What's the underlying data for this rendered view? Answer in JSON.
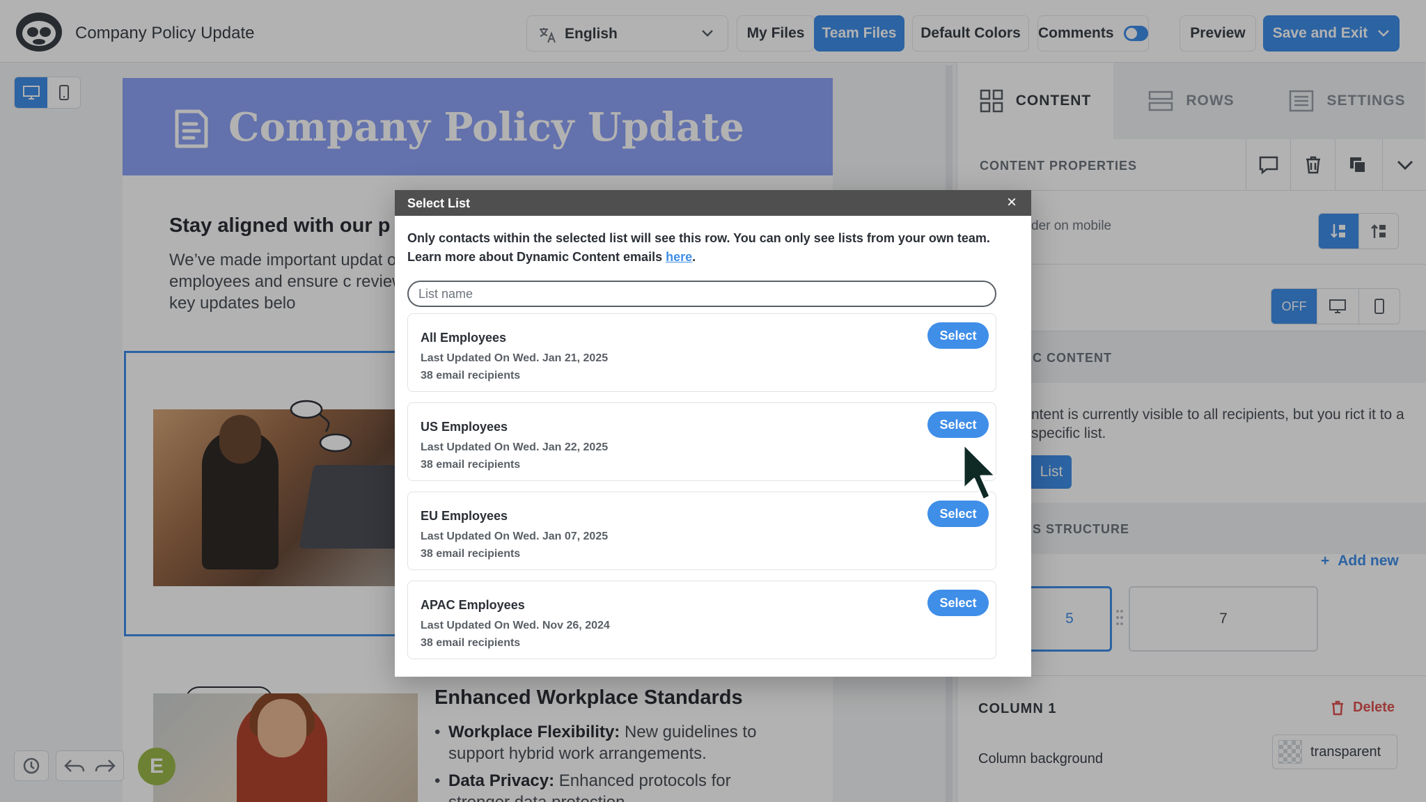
{
  "app": {
    "title": "Company Policy Update",
    "language": "English",
    "buttons": {
      "my_files": "My Files",
      "team_files": "Team Files",
      "default_colors": "Default Colors",
      "comments": "Comments",
      "preview": "Preview",
      "save_exit": "Save and Exit"
    },
    "comments_toggle_on": true
  },
  "email": {
    "hero_title": "Company Policy Update",
    "intro_heading": "Stay aligned with our p",
    "intro_text": "We’ve made important updat our employees and ensure c review the key updates belo",
    "rating_stars": "★★★★★",
    "section2_heading": "Enhanced Workplace Standards",
    "section2_items": [
      {
        "label": "Workplace Flexibility:",
        "text": " New guidelines to support hybrid work arrangements."
      },
      {
        "label": "Data Privacy:",
        "text": " Enhanced protocols for stronger data protection."
      }
    ],
    "avatar_initial": "E"
  },
  "panel": {
    "tabs": [
      "CONTENT",
      "ROWS",
      "SETTINGS"
    ],
    "active_tab": "CONTENT",
    "content_properties": "CONTENT  PROPERTIES",
    "row1_text": "der on mobile",
    "off_label": "OFF",
    "dynamic_header": "C CONTENT",
    "dynamic_body": "ntent is currently visible to all recipients, but you rict it to a specific list.",
    "list_button": "List",
    "structure_header": "S STRUCTURE",
    "add_new": "Add new",
    "columns": [
      "5",
      "7"
    ],
    "column1_heading": "COLUMN 1",
    "delete_label": "Delete",
    "column_background_label": "Column background",
    "column_background_value": "transparent"
  },
  "modal": {
    "title": "Select List",
    "close_glyph": "×",
    "description": "Only contacts within the selected list will see this row. You can only see lists from your own team. Learn more about Dynamic Content emails ",
    "description_link": "here",
    "description_end": ".",
    "search_placeholder": "List name",
    "select_label": "Select",
    "lists": [
      {
        "name": "All Employees",
        "updated": "Last Updated On Wed. Jan 21, 2025",
        "recipients": "38 email recipients"
      },
      {
        "name": "US Employees",
        "updated": "Last Updated On Wed. Jan 22, 2025",
        "recipients": "38 email recipients"
      },
      {
        "name": "EU Employees",
        "updated": "Last Updated On Wed. Jan 07, 2025",
        "recipients": "38 email recipients"
      },
      {
        "name": "APAC Employees",
        "updated": "Last Updated On Wed. Nov 26, 2024",
        "recipients": "38 email recipients"
      }
    ]
  },
  "colors": {
    "accent": "#3f8ee8",
    "hero_bg": "#8fa3f7",
    "modal_header": "#4f4f4f",
    "delete": "#e05252"
  }
}
